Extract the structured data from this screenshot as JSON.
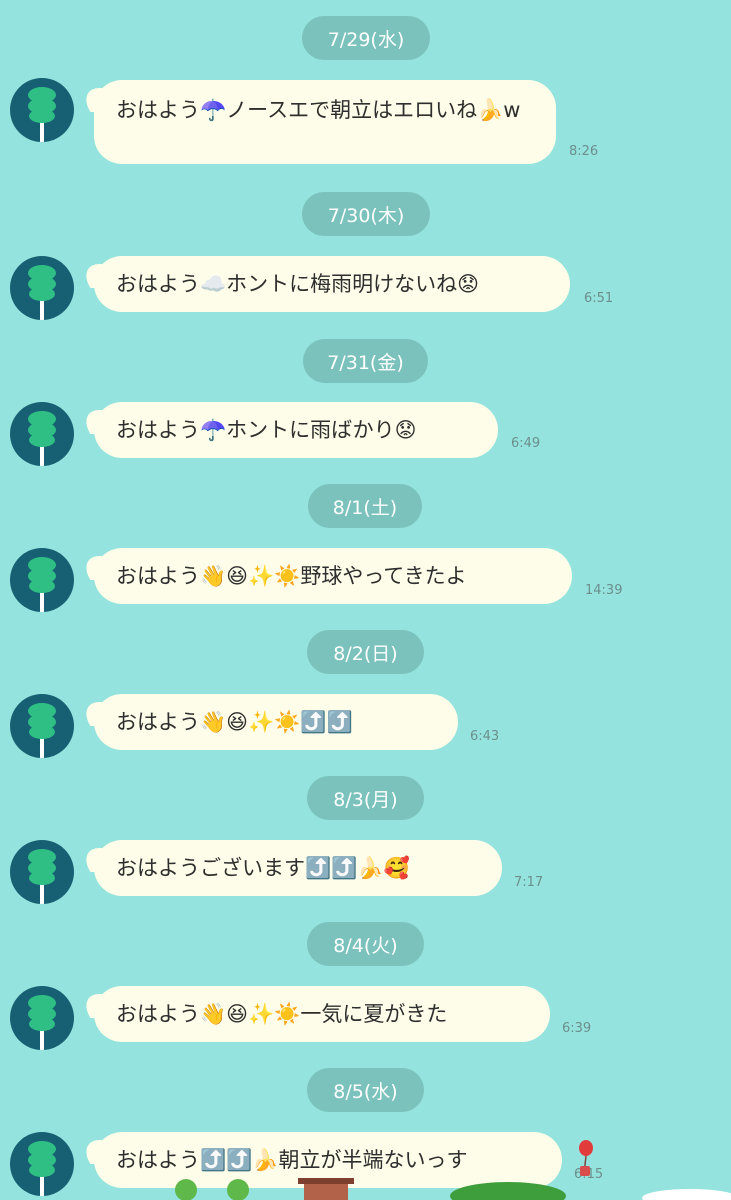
{
  "icons": {
    "avatar": "green-cactus-avatar",
    "scenery": "town-scenery-decoration",
    "balloon": "red-balloon"
  },
  "messages": [
    {
      "date": "7/29(水)",
      "text": "おはよう☂️ノースエで朝立はエロいね🍌w",
      "time": "8:26"
    },
    {
      "date": "7/30(木)",
      "text": "おはよう☁️ホントに梅雨明けないね😟",
      "time": "6:51"
    },
    {
      "date": "7/31(金)",
      "text": "おはよう☂️ホントに雨ばかり😟",
      "time": "6:49"
    },
    {
      "date": "8/1(土)",
      "text": "おはよう👋😆✨☀️野球やってきたよ",
      "time": "14:39"
    },
    {
      "date": "8/2(日)",
      "text": "おはよう👋😆✨☀️⤴️⤴️",
      "time": "6:43"
    },
    {
      "date": "8/3(月)",
      "text": "おはようございます⤴️⤴️🍌🥰",
      "time": "7:17"
    },
    {
      "date": "8/4(火)",
      "text": "おはよう👋😆✨☀️一気に夏がきた",
      "time": "6:39"
    },
    {
      "date": "8/5(水)",
      "text": "おはよう⤴️⤴️🍌朝立が半端ないっす",
      "time": "6:15"
    }
  ]
}
